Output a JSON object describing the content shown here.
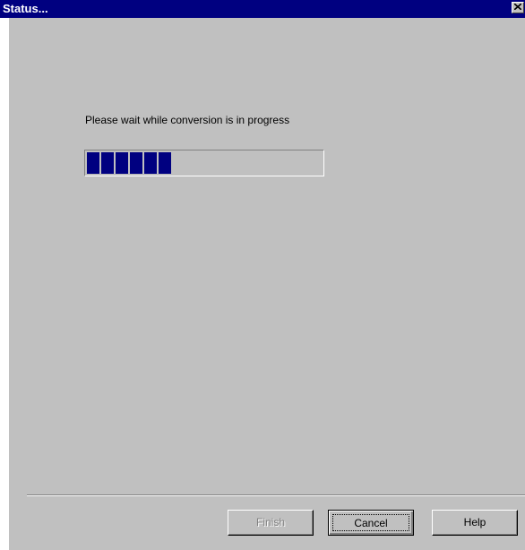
{
  "window": {
    "title": "Status...",
    "close_icon": "close-icon"
  },
  "main": {
    "message": "Please wait while conversion is in progress",
    "progress_fraction": 0.36
  },
  "buttons": {
    "finish_label": "Finish",
    "finish_enabled": false,
    "cancel_label": "Cancel",
    "help_label": "Help"
  },
  "colors": {
    "titlebar": "#000080",
    "window_bg": "#c0c0c0",
    "progress_fill": "#000080"
  }
}
